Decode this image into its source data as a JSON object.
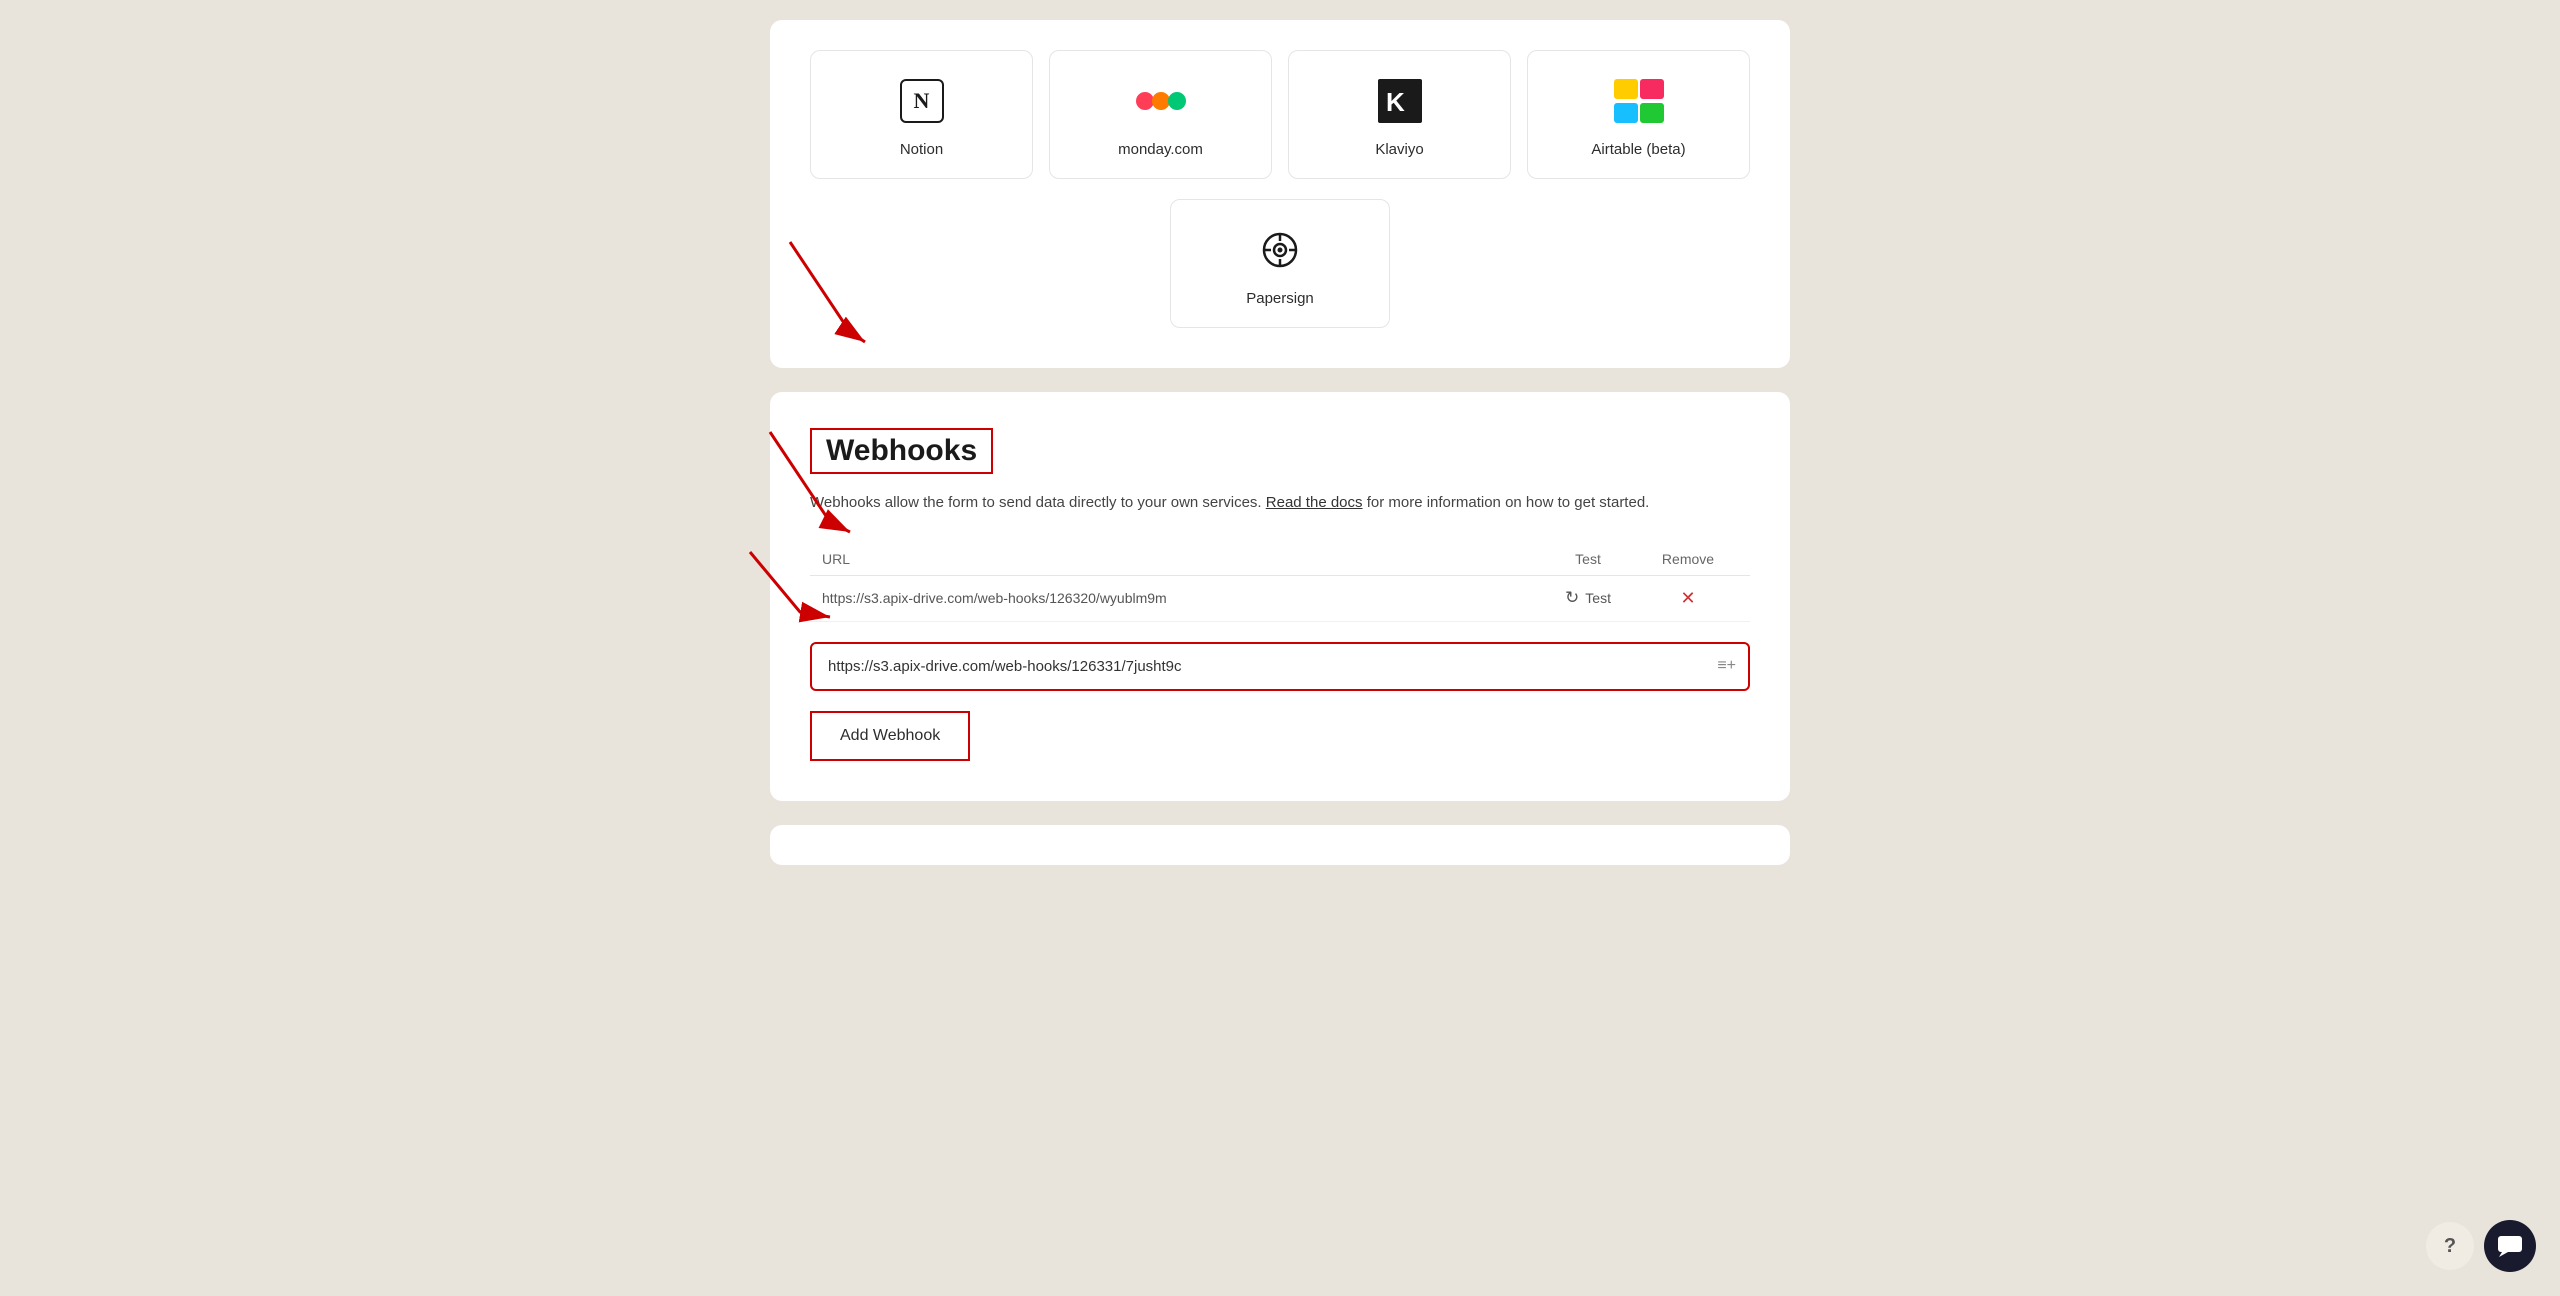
{
  "integrations": {
    "items": [
      {
        "name": "Notion",
        "icon_type": "notion"
      },
      {
        "name": "monday.com",
        "icon_type": "monday"
      },
      {
        "name": "Klaviyo",
        "icon_type": "klaviyo"
      },
      {
        "name": "Airtable (beta)",
        "icon_type": "airtable"
      }
    ],
    "extra_item": {
      "name": "Papersign",
      "icon_type": "papersign"
    }
  },
  "webhooks": {
    "title": "Webhooks",
    "description": "Webhooks allow the form to send data directly to your own services.",
    "docs_link_text": "Read the docs",
    "docs_suffix": "for more information on how to get started.",
    "table": {
      "columns": [
        "URL",
        "Test",
        "Remove"
      ],
      "rows": [
        {
          "url": "https://s3.apix-drive.com/web-hooks/126320/wyublm9m",
          "test_label": "Test",
          "has_remove": true
        }
      ]
    },
    "new_webhook_placeholder": "https://s3.apix-drive.com/web-hooks/126331/7jusht9c",
    "add_button_label": "Add Webhook"
  },
  "ui": {
    "help_label": "?",
    "icons": {
      "refresh": "↻",
      "close": "✕",
      "list_add": "≡+"
    }
  }
}
